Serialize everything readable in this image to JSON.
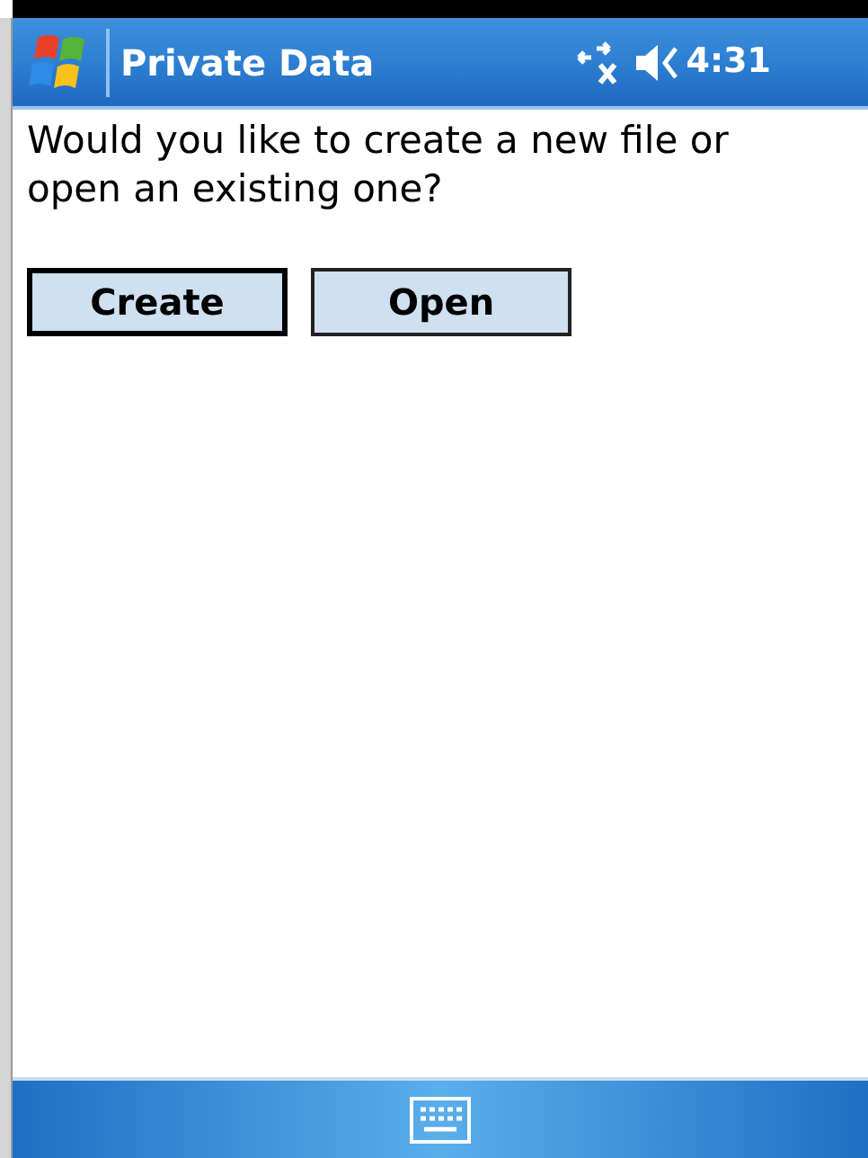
{
  "title_bar": {
    "title": "Private Data",
    "time": "4:31"
  },
  "message": "Would you like to create a new file or open an existing one?",
  "buttons": [
    {
      "label": "Create",
      "selected": true
    },
    {
      "label": "Open",
      "selected": false
    }
  ]
}
